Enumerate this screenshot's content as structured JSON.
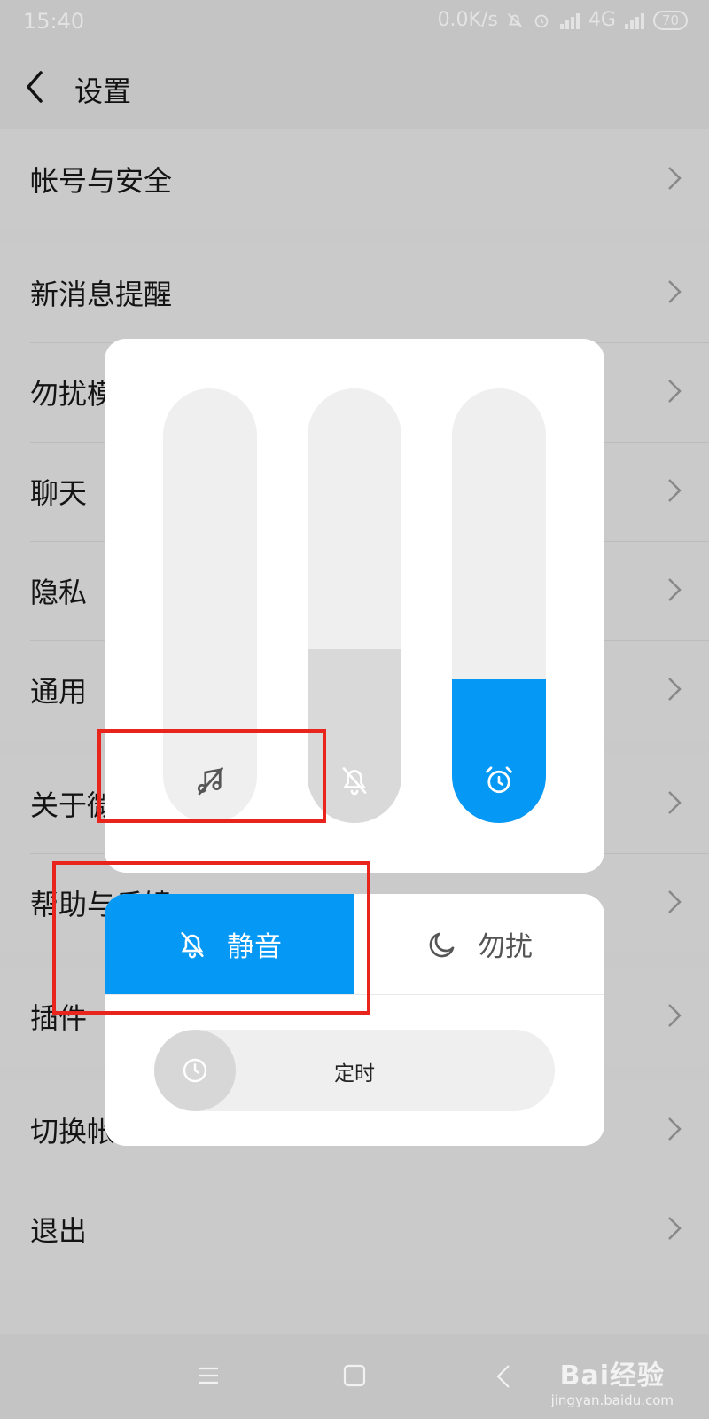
{
  "status_bar": {
    "time": "15:40",
    "network_speed": "0.0K/s",
    "network_type": "4G",
    "battery": "70"
  },
  "header": {
    "title": "设置"
  },
  "settings": {
    "groups": [
      {
        "items": [
          {
            "label": "帐号与安全"
          }
        ]
      },
      {
        "items": [
          {
            "label": "新消息提醒"
          },
          {
            "label": "勿扰模式"
          },
          {
            "label": "聊天"
          },
          {
            "label": "隐私"
          },
          {
            "label": "通用"
          }
        ]
      },
      {
        "items": [
          {
            "label": "关于微信"
          },
          {
            "label": "帮助与反馈"
          }
        ]
      },
      {
        "items": [
          {
            "label": "插件"
          }
        ]
      },
      {
        "items": [
          {
            "label": "切换帐号"
          },
          {
            "label": "退出"
          }
        ]
      }
    ]
  },
  "volume_panel": {
    "sliders": [
      {
        "icon": "music-muted-icon",
        "level": 0.0,
        "fill_color": "#efefef"
      },
      {
        "icon": "bell-off-icon",
        "level": 0.4,
        "fill_color": "#d9d9d9"
      },
      {
        "icon": "alarm-clock-icon",
        "level": 0.33,
        "fill_color": "#0599f5"
      }
    ]
  },
  "mode_panel": {
    "silent_label": "静音",
    "dnd_label": "勿扰",
    "timer_label": "定时",
    "active_mode": "silent",
    "accent_color": "#0599f5"
  },
  "watermark": {
    "logo": "Bai经验",
    "url": "jingyan.baidu.com"
  }
}
